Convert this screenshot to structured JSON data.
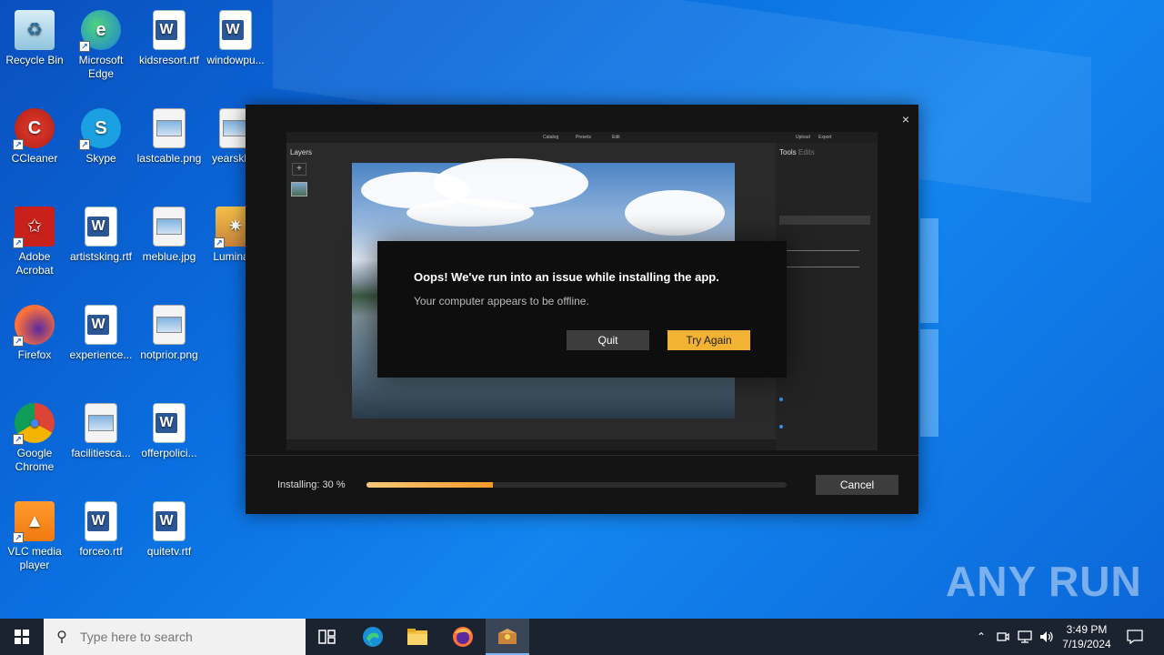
{
  "desktop": {
    "icons": [
      {
        "label": "Recycle Bin",
        "icon": "recycle-bin-icon"
      },
      {
        "label": "Microsoft Edge",
        "icon": "edge-icon"
      },
      {
        "label": "kidsresort.rtf",
        "icon": "word-document-icon"
      },
      {
        "label": "windowpu...",
        "icon": "word-document-icon"
      },
      {
        "label": "CCleaner",
        "icon": "ccleaner-icon"
      },
      {
        "label": "Skype",
        "icon": "skype-icon"
      },
      {
        "label": "lastcable.png",
        "icon": "image-file-icon"
      },
      {
        "label": "yearskb...",
        "icon": "image-file-icon"
      },
      {
        "label": "Adobe Acrobat",
        "icon": "acrobat-icon"
      },
      {
        "label": "artistsking.rtf",
        "icon": "word-document-icon"
      },
      {
        "label": "meblue.jpg",
        "icon": "image-file-icon"
      },
      {
        "label": "Lumina...",
        "icon": "luminar-icon"
      },
      {
        "label": "Firefox",
        "icon": "firefox-icon"
      },
      {
        "label": "experience...",
        "icon": "word-document-icon"
      },
      {
        "label": "notprior.png",
        "icon": "image-file-icon"
      },
      {
        "label": "Google Chrome",
        "icon": "chrome-icon"
      },
      {
        "label": "facilitiesca...",
        "icon": "image-file-icon"
      },
      {
        "label": "offerpolici...",
        "icon": "word-document-icon"
      },
      {
        "label": "VLC media player",
        "icon": "vlc-icon"
      },
      {
        "label": "forceo.rtf",
        "icon": "word-document-icon"
      },
      {
        "label": "quitetv.rtf",
        "icon": "word-document-icon"
      }
    ]
  },
  "installer": {
    "close_glyph": "×",
    "preview": {
      "topbar": {
        "catalog": "Catalog",
        "presets": "Presets",
        "edit": "Edit",
        "upload": "Upload",
        "export": "Export"
      },
      "layers_title": "Layers",
      "tools_title": "Tools",
      "edits_label": "Edits"
    },
    "error": {
      "title": "Oops! We've run into an issue while installing the app.",
      "message": "Your computer appears to be offline.",
      "quit_label": "Quit",
      "retry_label": "Try Again"
    },
    "status_text": "Installing: 30 %",
    "progress_fraction": 0.3,
    "cancel_label": "Cancel",
    "colors": {
      "accent": "#f2b233",
      "progress": "#f39a2b"
    }
  },
  "watermark": "ANY RUN",
  "taskbar": {
    "search_placeholder": "Type here to search",
    "clock_time": "3:49 PM",
    "clock_date": "7/19/2024"
  }
}
